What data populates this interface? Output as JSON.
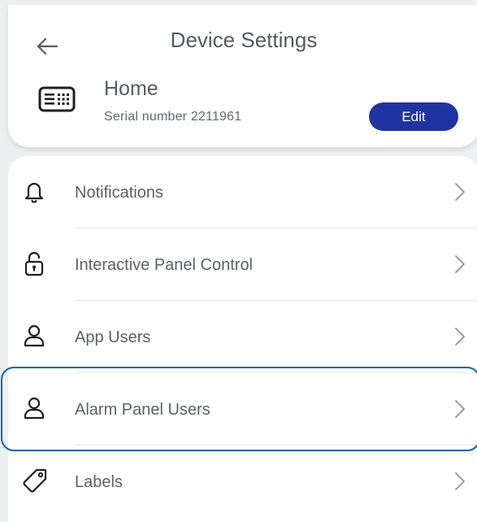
{
  "header": {
    "title": "Device Settings",
    "back_icon": "arrow-left-icon"
  },
  "device": {
    "name": "Home",
    "serial": "Serial number 2211961",
    "icon": "keypad-icon",
    "edit_label": "Edit"
  },
  "menu": [
    {
      "label": "Notifications",
      "icon": "bell-icon"
    },
    {
      "label": "Interactive Panel Control",
      "icon": "unlocked-padlock-icon"
    },
    {
      "label": "App Users",
      "icon": "user-icon"
    },
    {
      "label": "Alarm Panel Users",
      "icon": "user-icon",
      "highlighted": true
    },
    {
      "label": "Labels",
      "icon": "tag-icon"
    }
  ],
  "colors": {
    "accent": "#1f34a3",
    "highlight": "#0f62b2",
    "text": "#5a6068",
    "background": "#eeeff1"
  }
}
